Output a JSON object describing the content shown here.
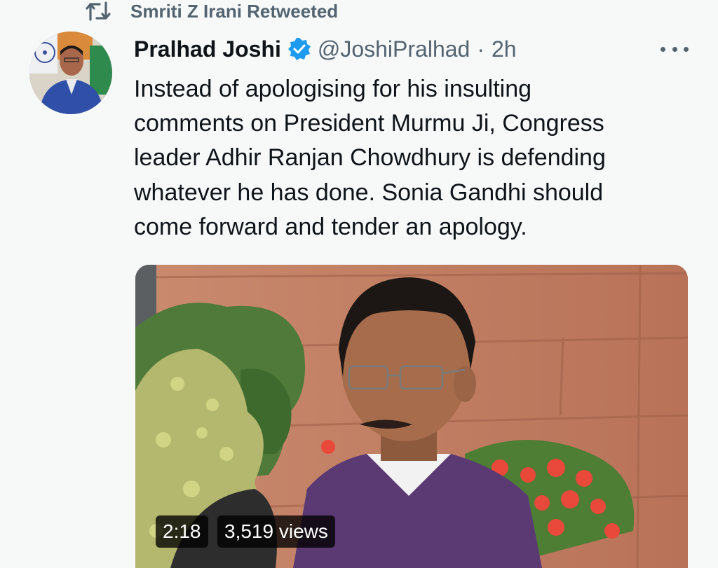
{
  "retweet": {
    "text": "Smriti Z Irani Retweeted",
    "icon": "retweet-icon"
  },
  "tweet": {
    "author_name": "Pralhad Joshi",
    "handle": "@JoshiPralhad",
    "separator": "·",
    "time": "2h",
    "verified_icon": "verified-badge-icon",
    "more_icon": "more-icon",
    "text_lines": [
      "Instead of apologising for his insulting",
      "comments on President Murmu Ji, Congress",
      "leader Adhir Ranjan Chowdhury is defending",
      "whatever he has done. Sonia Gandhi should",
      "come forward and tender an apology."
    ]
  },
  "media": {
    "duration": "2:18",
    "views": "3,519 views"
  },
  "colors": {
    "secondary_text": "#536471",
    "primary_text": "#0f1419",
    "verified_blue": "#1d9bf0",
    "background": "#f7f9f9"
  }
}
